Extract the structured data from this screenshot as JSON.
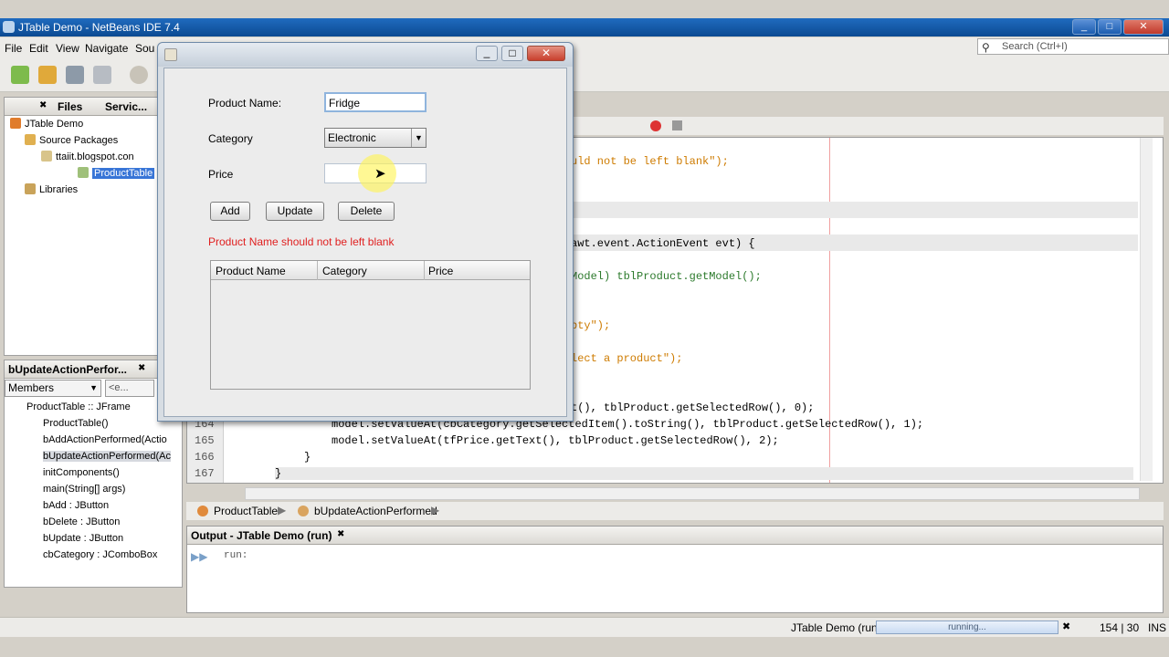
{
  "window": {
    "title": "JTable Demo - NetBeans IDE 7.4"
  },
  "menu": [
    "File",
    "Edit",
    "View",
    "Navigate",
    "Sou"
  ],
  "search": {
    "placeholder": "Search (Ctrl+I)"
  },
  "projects_panel": {
    "tabs": [
      "Files",
      "Servic..."
    ],
    "tree": [
      {
        "label": "JTable Demo",
        "level": 0
      },
      {
        "label": "Source Packages",
        "level": 1
      },
      {
        "label": "ttaiit.blogspot.con",
        "level": 2
      },
      {
        "label": "ProductTable",
        "level": 3,
        "selected": true
      },
      {
        "label": "Libraries",
        "level": 1
      }
    ]
  },
  "navigator": {
    "title": "bUpdateActionPerfor...",
    "members_label": "Members",
    "filter_label": "<e...",
    "root": "ProductTable :: JFrame",
    "items": [
      "ProductTable()",
      "bAddActionPerformed(Actio",
      "bUpdateActionPerformed(Ac",
      "initComponents()",
      "main(String[] args)",
      "bAdd : JButton",
      "bDelete : JButton",
      "bUpdate : JButton",
      "cbCategory : JComboBox"
    ]
  },
  "editor": {
    "lines": [
      {
        "num": "",
        "text": "uld not be left blank\");"
      },
      {
        "num": "",
        "text": "awt.event.ActionEvent evt) {"
      },
      {
        "num": "",
        "text": "Model) tblProduct.getModel();"
      },
      {
        "num": "",
        "text": "pty\");"
      },
      {
        "num": "",
        "text": "lect a product\");"
      },
      {
        "num": "",
        "text": "t(), tblProduct.getSelectedRow(), 0);"
      },
      {
        "num": "164",
        "text": "model.setValueAt(cbCategory.getSelectedItem().toString(), tblProduct.getSelectedRow(), 1);"
      },
      {
        "num": "165",
        "text": "model.setValueAt(tfPrice.getText(), tblProduct.getSelectedRow(), 2);"
      },
      {
        "num": "166",
        "text": "}"
      },
      {
        "num": "167",
        "text": "}"
      }
    ],
    "breadcrumb": [
      "ProductTable",
      "bUpdateActionPerformed"
    ]
  },
  "dialog": {
    "labels": {
      "name": "Product Name:",
      "category": "Category",
      "price": "Price"
    },
    "values": {
      "name": "Fridge",
      "category": "Electronic",
      "price": ""
    },
    "buttons": {
      "add": "Add",
      "update": "Update",
      "delete": "Delete"
    },
    "error": "Product Name should not be left blank",
    "error_color": "#e02020",
    "table_headers": [
      "Product Name",
      "Category",
      "Price"
    ]
  },
  "output": {
    "title": "Output - JTable Demo (run)",
    "text": "run:"
  },
  "status": {
    "project": "JTable Demo (run)",
    "progress_text": "running...",
    "position": "154 | 30",
    "mode": "INS"
  }
}
